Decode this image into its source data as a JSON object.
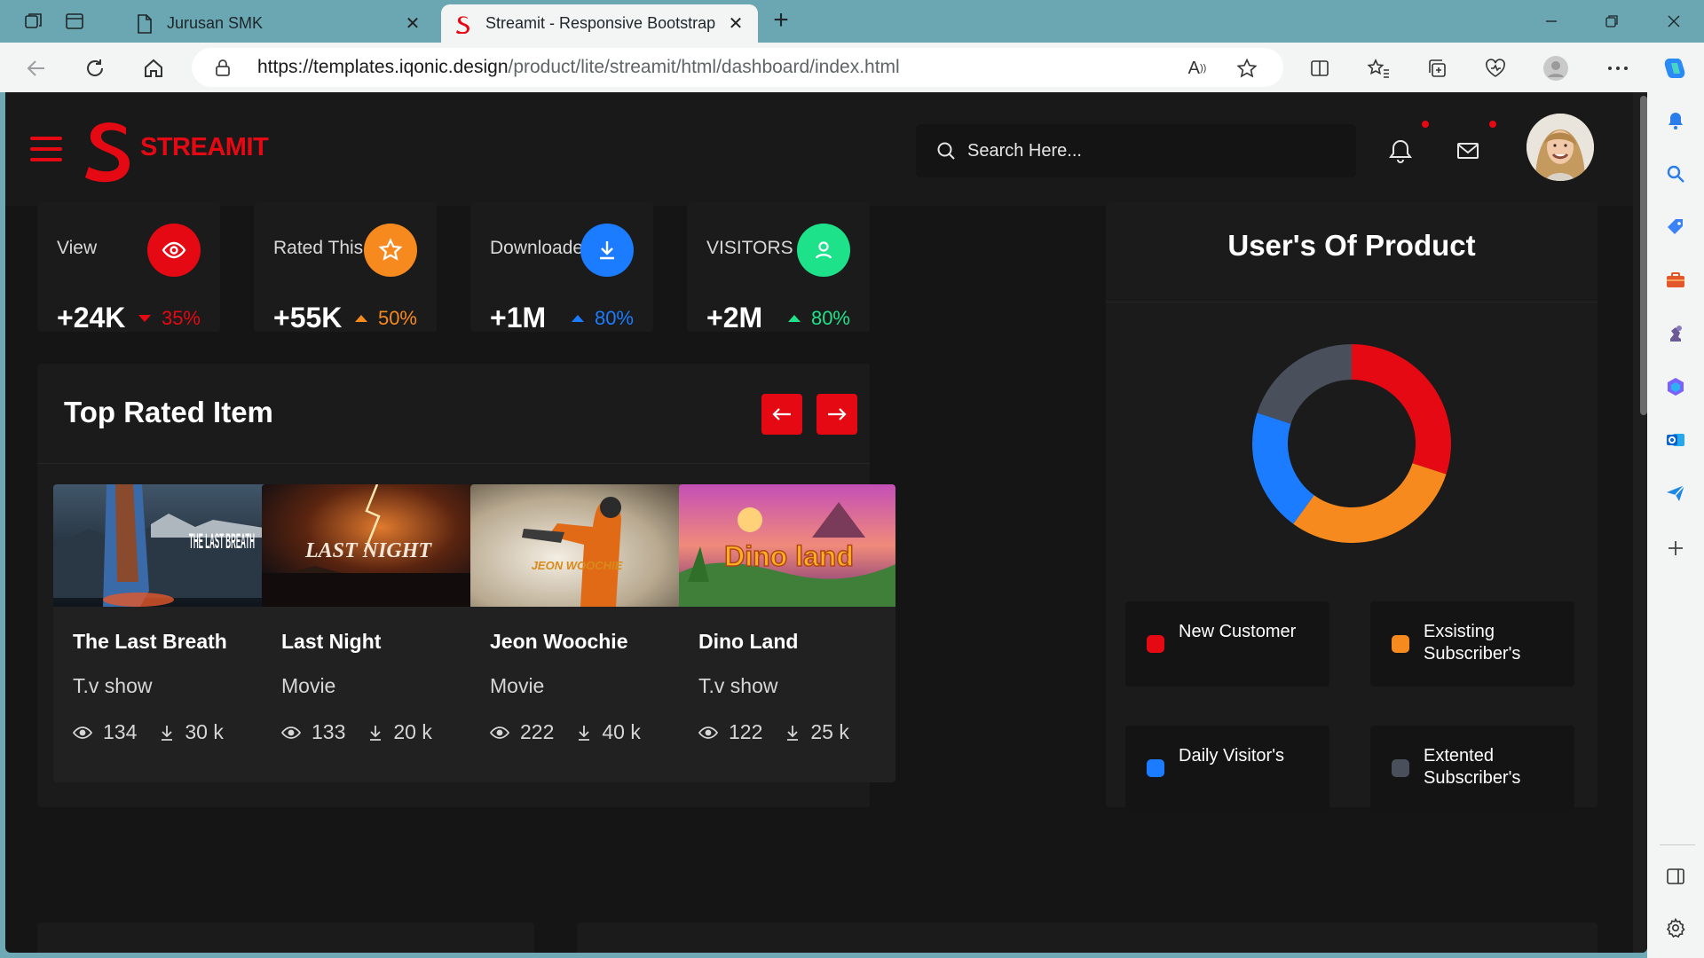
{
  "browser": {
    "tabs": [
      {
        "title": "Jurusan SMK",
        "active": false
      },
      {
        "title": "Streamit - Responsive Bootstrap",
        "active": true
      }
    ],
    "url_host": "https://templates.iqonic.design",
    "url_path": "/product/lite/streamit/html/dashboard/index.html"
  },
  "app": {
    "brand": "STREAMIT",
    "search_placeholder": "Search Here..."
  },
  "stats": [
    {
      "label": "View",
      "value": "+24K",
      "change": "35%",
      "direction": "down",
      "color": "#e50914",
      "icon": "eye-icon"
    },
    {
      "label": "Rated This App",
      "value": "+55K",
      "change": "50%",
      "direction": "up",
      "color": "#f68a1f",
      "icon": "star-icon"
    },
    {
      "label": "Downloaded",
      "value": "+1M",
      "change": "80%",
      "direction": "up",
      "color": "#1c7cff",
      "icon": "download-icon"
    },
    {
      "label": "VISITORS",
      "value": "+2M",
      "change": "80%",
      "direction": "up",
      "color": "#1ee28a",
      "icon": "user-icon"
    }
  ],
  "top_rated": {
    "title": "Top Rated Item",
    "items": [
      {
        "name": "The Last Breath",
        "type": "T.v show",
        "views": "134",
        "downloads": "30 k",
        "thumb_text": "THE LAST BREATH"
      },
      {
        "name": "Last Night",
        "type": "Movie",
        "views": "133",
        "downloads": "20 k",
        "thumb_text": "LAST NIGHT"
      },
      {
        "name": "Jeon Woochie",
        "type": "Movie",
        "views": "222",
        "downloads": "40 k",
        "thumb_text": "JEON WOOCHIE"
      },
      {
        "name": "Dino Land",
        "type": "T.v show",
        "views": "122",
        "downloads": "25 k",
        "thumb_text": "Dino land"
      }
    ]
  },
  "users_of_product": {
    "title": "User's Of Product",
    "legend": [
      {
        "label": "New Customer",
        "color": "#e50914"
      },
      {
        "label": "Exsisting Subscriber's",
        "color": "#f68a1f"
      },
      {
        "label": "Daily Visitor's",
        "color": "#1c7cff"
      },
      {
        "label": "Extented Subscriber's",
        "color": "#4a4f5c"
      }
    ]
  },
  "chart_data": {
    "type": "pie",
    "title": "User's Of Product",
    "donut": true,
    "categories": [
      "New Customer",
      "Exsisting Subscriber's",
      "Daily Visitor's",
      "Extented Subscriber's"
    ],
    "values": [
      30,
      30,
      20,
      20
    ],
    "colors": [
      "#e50914",
      "#f68a1f",
      "#1c7cff",
      "#4a4f5c"
    ]
  }
}
